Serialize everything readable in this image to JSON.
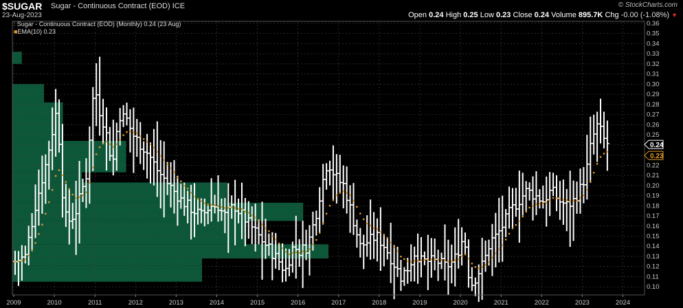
{
  "header": {
    "symbol": "$SUGAR",
    "name": "Sugar - Continuous Contract (EOD)",
    "exchange": "ICE",
    "date": "23-Aug-2023",
    "brand": "© StockCharts.com",
    "open_label": "Open",
    "open": "0.24",
    "high_label": "High",
    "high": "0.25",
    "low_label": "Low",
    "low": "0.23",
    "close_label": "Close",
    "close": "0.24",
    "volume_label": "Volume",
    "volume": "895.7K",
    "chg_label": "Chg",
    "chg": "-0.00 (-1.08%)"
  },
  "legend": {
    "line1": "Sugar - Continuous Contract (EOD) (Monthly) 0.24 (23 Aug)",
    "line2": "EMA(10) 0.23"
  },
  "colors": {
    "bars": "#ffffff",
    "ema": "#e49a2a",
    "volume_profile": "#0e5c3c",
    "grid": "#444444",
    "background": "#000000"
  },
  "chart_data": {
    "type": "ohlc",
    "interval": "Monthly",
    "ylim": [
      0.092,
      0.362
    ],
    "yticks": [
      0.1,
      0.11,
      0.12,
      0.13,
      0.14,
      0.15,
      0.16,
      0.17,
      0.18,
      0.19,
      0.2,
      0.21,
      0.22,
      0.23,
      0.24,
      0.25,
      0.26,
      0.27,
      0.28,
      0.29,
      0.3,
      0.31,
      0.32,
      0.33,
      0.34,
      0.35,
      0.36
    ],
    "xticks": [
      "2009",
      "2010",
      "2011",
      "2012",
      "2013",
      "2014",
      "2015",
      "2016",
      "2017",
      "2018",
      "2019",
      "2020",
      "2021",
      "2022",
      "2023",
      "2024"
    ],
    "last_price_label": "0.24",
    "ema_label": "0.23",
    "anchors": [
      [
        2009.0,
        0.125
      ],
      [
        2009.25,
        0.13
      ],
      [
        2009.5,
        0.18
      ],
      [
        2009.75,
        0.22
      ],
      [
        2010.0,
        0.27
      ],
      [
        2010.1,
        0.24
      ],
      [
        2010.2,
        0.17
      ],
      [
        2010.35,
        0.165
      ],
      [
        2010.5,
        0.175
      ],
      [
        2010.75,
        0.21
      ],
      [
        2010.95,
        0.3
      ],
      [
        2011.1,
        0.27
      ],
      [
        2011.2,
        0.26
      ],
      [
        2011.4,
        0.22
      ],
      [
        2011.55,
        0.27
      ],
      [
        2011.75,
        0.265
      ],
      [
        2011.9,
        0.25
      ],
      [
        2012.1,
        0.24
      ],
      [
        2012.3,
        0.23
      ],
      [
        2012.5,
        0.215
      ],
      [
        2012.7,
        0.205
      ],
      [
        2012.9,
        0.195
      ],
      [
        2013.1,
        0.185
      ],
      [
        2013.4,
        0.175
      ],
      [
        2013.6,
        0.17
      ],
      [
        2013.8,
        0.18
      ],
      [
        2014.0,
        0.18
      ],
      [
        2014.15,
        0.17
      ],
      [
        2014.4,
        0.18
      ],
      [
        2014.6,
        0.17
      ],
      [
        2014.8,
        0.16
      ],
      [
        2015.0,
        0.15
      ],
      [
        2015.3,
        0.135
      ],
      [
        2015.5,
        0.125
      ],
      [
        2015.65,
        0.115
      ],
      [
        2015.85,
        0.14
      ],
      [
        2016.0,
        0.135
      ],
      [
        2016.2,
        0.14
      ],
      [
        2016.4,
        0.17
      ],
      [
        2016.55,
        0.2
      ],
      [
        2016.7,
        0.225
      ],
      [
        2016.8,
        0.215
      ],
      [
        2016.95,
        0.205
      ],
      [
        2017.1,
        0.2
      ],
      [
        2017.3,
        0.17
      ],
      [
        2017.5,
        0.14
      ],
      [
        2017.7,
        0.145
      ],
      [
        2017.9,
        0.15
      ],
      [
        2018.1,
        0.14
      ],
      [
        2018.3,
        0.125
      ],
      [
        2018.5,
        0.11
      ],
      [
        2018.7,
        0.12
      ],
      [
        2018.85,
        0.135
      ],
      [
        2019.0,
        0.125
      ],
      [
        2019.2,
        0.125
      ],
      [
        2019.4,
        0.125
      ],
      [
        2019.6,
        0.12
      ],
      [
        2019.8,
        0.125
      ],
      [
        2020.0,
        0.145
      ],
      [
        2020.1,
        0.14
      ],
      [
        2020.2,
        0.1
      ],
      [
        2020.35,
        0.11
      ],
      [
        2020.55,
        0.125
      ],
      [
        2020.7,
        0.145
      ],
      [
        2020.85,
        0.15
      ],
      [
        2021.0,
        0.16
      ],
      [
        2021.2,
        0.175
      ],
      [
        2021.4,
        0.185
      ],
      [
        2021.6,
        0.195
      ],
      [
        2021.8,
        0.19
      ],
      [
        2022.0,
        0.185
      ],
      [
        2022.2,
        0.195
      ],
      [
        2022.4,
        0.185
      ],
      [
        2022.6,
        0.18
      ],
      [
        2022.75,
        0.185
      ],
      [
        2022.9,
        0.195
      ],
      [
        2023.05,
        0.21
      ],
      [
        2023.2,
        0.245
      ],
      [
        2023.35,
        0.26
      ],
      [
        2023.5,
        0.245
      ],
      [
        2023.62,
        0.24
      ]
    ],
    "volume_profile": [
      {
        "low": 0.105,
        "high": 0.121,
        "weight": 0.3
      },
      {
        "low": 0.121,
        "high": 0.128,
        "weight": 0.3
      },
      {
        "low": 0.128,
        "high": 0.142,
        "weight": 0.5
      },
      {
        "low": 0.142,
        "high": 0.152,
        "weight": 0.37
      },
      {
        "low": 0.152,
        "high": 0.165,
        "weight": 0.37
      },
      {
        "low": 0.165,
        "high": 0.183,
        "weight": 0.46
      },
      {
        "low": 0.183,
        "high": 0.203,
        "weight": 0.34
      },
      {
        "low": 0.203,
        "high": 0.213,
        "weight": 0.11
      },
      {
        "low": 0.213,
        "high": 0.227,
        "weight": 0.18
      },
      {
        "low": 0.227,
        "high": 0.244,
        "weight": 0.18
      },
      {
        "low": 0.244,
        "high": 0.265,
        "weight": 0.08
      },
      {
        "low": 0.265,
        "high": 0.282,
        "weight": 0.08
      },
      {
        "low": 0.282,
        "high": 0.3,
        "weight": 0.05
      },
      {
        "low": 0.32,
        "high": 0.332,
        "weight": 0.015
      }
    ]
  }
}
